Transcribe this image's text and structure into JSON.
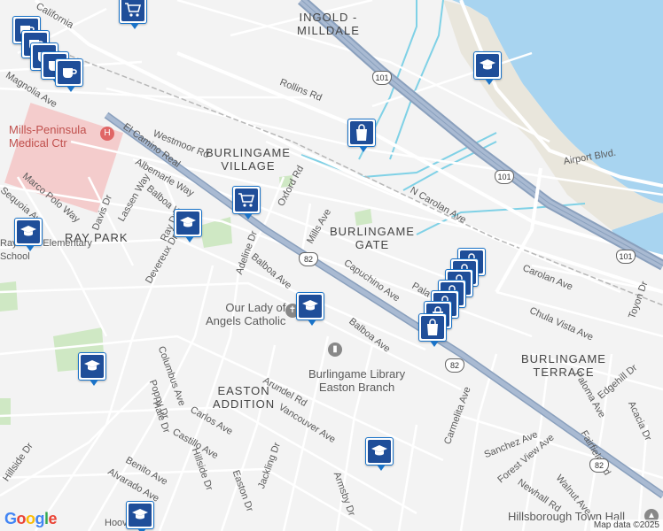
{
  "map": {
    "areas": [
      "INGOLD -\nMILLDALE",
      "BURLINGAME\nVILLAGE",
      "RAY PARK",
      "BURLINGAME\nGATE",
      "BURLINGAME\nTERRACE",
      "EASTON\nADDITION"
    ],
    "pois": [
      "Mills-Peninsula\nMedical Ctr",
      "Our Lady of\nAngels Catholic",
      "Burlingame Library\nEaston Branch",
      "Hillsborough Town Hall",
      "Ray Park Elementary\nSchool"
    ],
    "streets": [
      "California",
      "Magnolia Ave",
      "Rollins Rd",
      "Westmoor Rd",
      "El Camino Real",
      "Albemarle Way",
      "Balboa Way",
      "Oxford Rd",
      "Marco Polo Way",
      "Davis Dr",
      "Lassen Way",
      "Sequoia Av",
      "Ray Dr",
      "Devereux Dr",
      "Adeline Dr",
      "Balboa Ave",
      "Mills Ave",
      "Capuchino Ave",
      "N Carolan Ave",
      "Carolan Ave",
      "Airport Blvd.",
      "Chula Vista Ave",
      "Toyon Dr",
      "Balboa Ave",
      "Columbus Ave",
      "Poppy Dr",
      "Hale Dr",
      "Carlos Ave",
      "Castillo Ave",
      "Benito Ave",
      "Alvarado Ave",
      "Hillside Dr",
      "Easton Dr",
      "Jackling Dr",
      "Vancouver Ave",
      "Arundel Rd",
      "Armsby Dr",
      "Carmelita Ave",
      "Sanchez Ave",
      "Forest View Ave",
      "Newhall Rd",
      "Walnut Ave",
      "Fairfield Rd",
      "Edgehill Dr",
      "Paloma Ave",
      "Acacia Dr",
      "Hoover",
      "Pala",
      "Hillside Dr"
    ],
    "shields": [
      "101",
      "101",
      "101",
      "82",
      "82",
      "82"
    ]
  },
  "markers": [
    {
      "icon": "coffee-icon"
    },
    {
      "icon": "coffee-icon"
    },
    {
      "icon": "coffee-icon"
    },
    {
      "icon": "coffee-icon"
    },
    {
      "icon": "coffee-icon"
    },
    {
      "icon": "cart-icon"
    },
    {
      "icon": "cart-icon"
    },
    {
      "icon": "shopping-bag-icon"
    },
    {
      "icon": "shopping-bag-icon"
    },
    {
      "icon": "shopping-bag-icon"
    },
    {
      "icon": "shopping-bag-icon"
    },
    {
      "icon": "shopping-bag-icon"
    },
    {
      "icon": "shopping-bag-icon"
    },
    {
      "icon": "shopping-bag-icon"
    },
    {
      "icon": "shopping-bag-icon"
    },
    {
      "icon": "school-icon"
    },
    {
      "icon": "school-icon"
    },
    {
      "icon": "school-icon"
    },
    {
      "icon": "school-icon"
    },
    {
      "icon": "school-icon"
    },
    {
      "icon": "school-icon"
    },
    {
      "icon": "school-icon"
    }
  ],
  "footer": {
    "logo": "Google",
    "attribution": "Map data ©2025"
  },
  "colors": {
    "water": "#a8d4f0",
    "freeway": "#8aa0bd",
    "arterial": "#ffffff",
    "park": "#cfe8c4",
    "hospital": "#f4cccc",
    "pin": "#1a73c8",
    "pin_fill": "#1f4e99"
  }
}
